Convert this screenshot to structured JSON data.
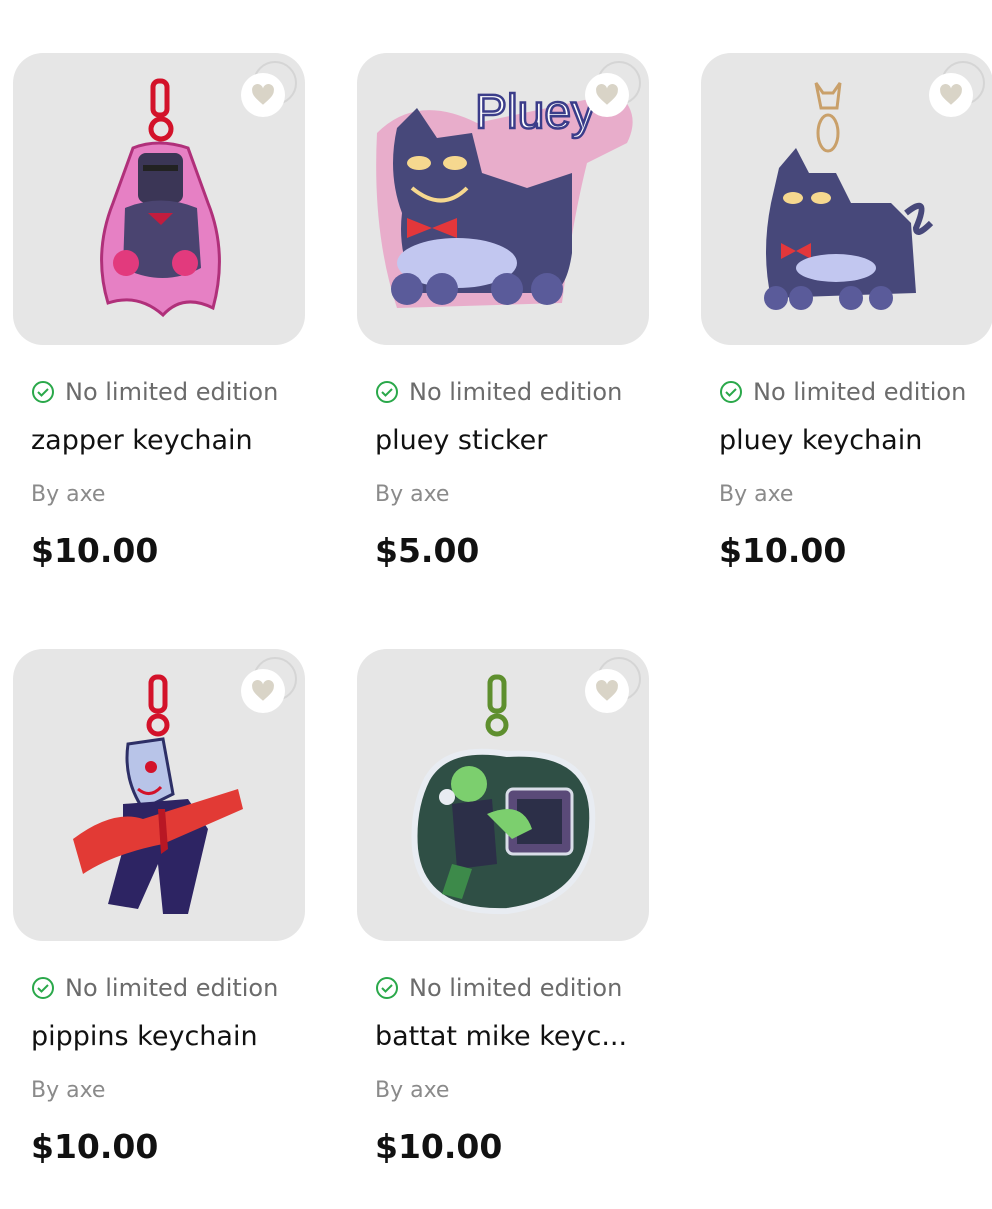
{
  "products": [
    {
      "edition": "No limited edition",
      "title": "zapper keychain",
      "byline": "By axe",
      "price": "$10.00",
      "art": "zapper-keychain-art"
    },
    {
      "edition": "No limited edition",
      "title": "pluey sticker",
      "byline": "By axe",
      "price": "$5.00",
      "art": "pluey-sticker-art",
      "art_text": "Pluey"
    },
    {
      "edition": "No limited edition",
      "title": "pluey keychain",
      "byline": "By axe",
      "price": "$10.00",
      "art": "pluey-keychain-art"
    },
    {
      "edition": "No limited edition",
      "title": "pippins keychain",
      "byline": "By axe",
      "price": "$10.00",
      "art": "pippins-keychain-art"
    },
    {
      "edition": "No limited edition",
      "title": "battat mike keyc...",
      "byline": "By axe",
      "price": "$10.00",
      "art": "battat-mike-keychain-art"
    }
  ],
  "icons": {
    "favorite": "heart-icon",
    "status": "check-circle-icon"
  },
  "colors": {
    "thumb_bg": "#e6e6e6",
    "check": "#2aa84a",
    "heart": "#d9d4c7"
  }
}
